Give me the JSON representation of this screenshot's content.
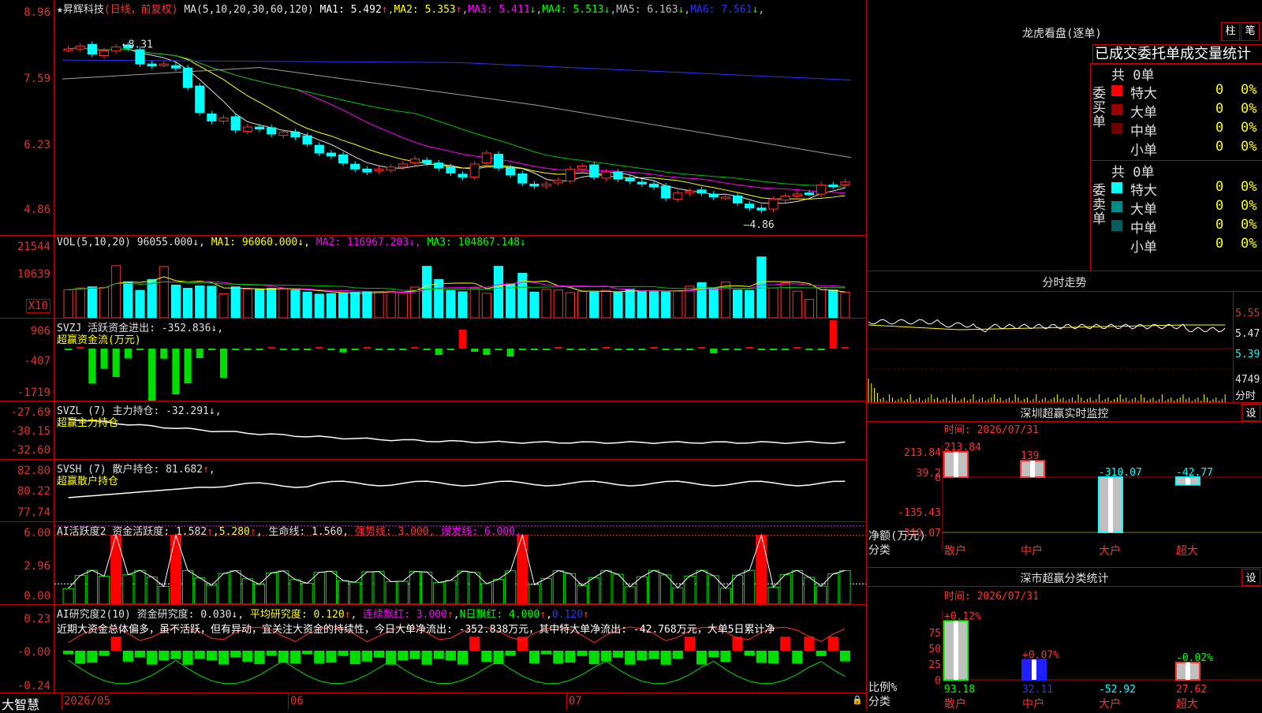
{
  "app": {
    "brand": "大智慧",
    "lock": "🔒"
  },
  "k": {
    "title": "★昇辉科技",
    "mode": "(日线，前复权)",
    "ma_head": "MA(5,10,20,30,60,120)",
    "ma": [
      {
        "t": "MA1: 5.492",
        "a": "↑",
        "c": "#ffffff"
      },
      {
        "t": "MA2: 5.353",
        "a": "↑",
        "c": "#ffff00"
      },
      {
        "t": "MA3: 5.411",
        "a": "↓",
        "c": "#ff00ff"
      },
      {
        "t": "MA4: 5.513",
        "a": "↓",
        "c": "#00ff00"
      },
      {
        "t": "MA5: 6.163",
        "a": "↓",
        "c": "#c0c0c0"
      },
      {
        "t": "MA6: 7.561",
        "a": "↓",
        "c": "#3030ff"
      }
    ],
    "ticks": [
      "8.96",
      "7.59",
      "6.23",
      "4.86"
    ],
    "hi": "8.31",
    "lo": "4.86"
  },
  "vol": {
    "head": "VOL(5,10,20)",
    "v": "96055.000",
    "ma1": "MA1: 96060.000",
    "ma2": "MA2: 116967.203",
    "ma3": "MA3: 104867.148",
    "ticks": [
      "21544",
      "10639"
    ],
    "unit": "X10"
  },
  "svzj": {
    "head": "SVZJ  活跃资金进出: -352.836",
    "sub": "超赢资金流(万元)",
    "ticks": [
      "906",
      "-407",
      "-1719"
    ]
  },
  "svzl": {
    "head": "SVZL (7) 主力持仓: -32.291",
    "sub": "超赢主力持仓",
    "ticks": [
      "-27.69",
      "-30.15",
      "-32.60"
    ]
  },
  "svsh": {
    "head": "SVSH (7) 散户持仓: 81.682",
    "sub": "超赢散户持仓",
    "ticks": [
      "82.80",
      "80.22",
      "77.74"
    ]
  },
  "ai2": {
    "head": "AI活跃度2 资金活跃度: 1.582",
    "v2": "5.280",
    "life": "生命线: 1.560",
    "strong": "强势线: 3.000",
    "burst": "爆发线: 6.000",
    "ticks": [
      "6.00",
      "2.96",
      "0.00"
    ]
  },
  "ai_r": {
    "head": "AI研究度2(10) 资金研究度: 0.030",
    "avg": "平均研究度: 0.120",
    "cont": "连续飘红: 3.000",
    "n": "N日飘红: 4.000",
    "n2": "0.120",
    "text": "近期大资金总体偏多，虽不活跃，但有异动，宜关注大资金的持续性，今日大单净流出: -352.838万元，其中特大单净流出: -42.768万元，大单5日累计净",
    "ticks": [
      "0.23",
      "-0.00",
      "-0.24"
    ]
  },
  "xaxis": [
    "2026/05",
    "06",
    "07"
  ],
  "lhb": {
    "title": "龙虎看盘(逐单)",
    "b1": "柱",
    "b2": "笔",
    "sub": "已成交委托单成交量统计",
    "buy": {
      "label": "委买单",
      "total": "共 0单",
      "rows": [
        {
          "n": "特大",
          "v": "0",
          "p": "0%",
          "c": "#ff0000"
        },
        {
          "n": "大单",
          "v": "0",
          "p": "0%",
          "c": "#a00000"
        },
        {
          "n": "中单",
          "v": "0",
          "p": "0%",
          "c": "#700000"
        },
        {
          "n": "小单",
          "v": "0",
          "p": "0%",
          "c": "#000000"
        }
      ]
    },
    "sell": {
      "label": "委卖单",
      "total": "共 0单",
      "rows": [
        {
          "n": "特大",
          "v": "0",
          "p": "0%",
          "c": "#00ffff"
        },
        {
          "n": "大单",
          "v": "0",
          "p": "0%",
          "c": "#008b8b"
        },
        {
          "n": "中单",
          "v": "0",
          "p": "0%",
          "c": "#006060"
        },
        {
          "n": "小单",
          "v": "0",
          "p": "0%",
          "c": "#000000"
        }
      ]
    }
  },
  "fs": {
    "title": "分时走势",
    "ticks": [
      "5.55",
      "5.47",
      "5.39"
    ],
    "vol": "4749",
    "vlabel": "分时"
  },
  "szm": {
    "title": "深圳超赢实时监控",
    "btn": "设",
    "time": "时间: 2026/07/31",
    "ticks": [
      "213.84",
      "39.2",
      "0",
      "-135.43",
      "-310.07"
    ],
    "ylabel": "净额(万元)",
    "xlabel": "分类",
    "cats": [
      "散户",
      "中户",
      "大户",
      "超大"
    ],
    "labels": [
      "213.84",
      "139",
      "-310.07",
      "-42.77"
    ],
    "values": [
      213.84,
      139,
      -310.07,
      -42.77
    ]
  },
  "szc": {
    "title": "深市超赢分类统计",
    "btn": "设",
    "time": "时间: 2026/07/31",
    "ticks": [
      "75",
      "50",
      "25",
      "0"
    ],
    "ylabel": "比例%",
    "xlabel": "分类",
    "cats": [
      "散户",
      "中户",
      "大户",
      "超大"
    ],
    "top": [
      "+0.12%",
      "+0.07%",
      "",
      "-0.02%"
    ],
    "bottom": [
      "93.18",
      "32.11",
      "-52.92",
      "27.62"
    ],
    "values": [
      93.18,
      32.11,
      0,
      27.62
    ]
  },
  "chart_data": [
    {
      "type": "candlestick",
      "title": "昇辉科技",
      "ylim": [
        4.5,
        9.2
      ],
      "y_ticks": [
        8.96,
        7.59,
        6.23,
        4.86
      ],
      "x_ticks": [
        "2026/05",
        "06",
        "07"
      ],
      "high": 8.31,
      "low": 4.86,
      "close": [
        8.22,
        8.28,
        8.12,
        8.18,
        8.26,
        8.24,
        7.92,
        7.88,
        7.92,
        7.84,
        7.45,
        6.95,
        6.78,
        6.84,
        6.6,
        6.66,
        6.62,
        6.52,
        6.56,
        6.46,
        6.32,
        6.14,
        6.08,
        5.94,
        5.82,
        5.76,
        5.82,
        5.86,
        5.92,
        6.02,
        5.94,
        5.84,
        5.74,
        5.66,
        5.92,
        6.14,
        5.84,
        5.7,
        5.54,
        5.48,
        5.52,
        5.6,
        5.82,
        5.88,
        5.66,
        5.76,
        5.62,
        5.58,
        5.52,
        5.46,
        5.24,
        5.34,
        5.38,
        5.34,
        5.26,
        5.26,
        5.14,
        5.04,
        5.0,
        5.22,
        5.28,
        5.32,
        5.34,
        5.5,
        5.48,
        5.56
      ]
    },
    {
      "type": "bar",
      "title": "VOL",
      "ylim": [
        0,
        28000
      ],
      "values": [
        9600,
        10200,
        10600,
        10400,
        17800,
        12300,
        9400,
        13100,
        17500,
        11200,
        10100,
        10900,
        10800,
        8200,
        10600,
        9800,
        9900,
        10100,
        9900,
        9500,
        8800,
        8100,
        8300,
        8400,
        8700,
        8900,
        9000,
        9100,
        8400,
        10500,
        17600,
        13100,
        9300,
        8900,
        10200,
        8400,
        17600,
        11600,
        15200,
        8800,
        9700,
        9500,
        8600,
        9000,
        8800,
        9400,
        8700,
        9800,
        9200,
        9100,
        8900,
        9100,
        10800,
        12000,
        10300,
        12200,
        9500,
        9300,
        20800,
        10200,
        12000,
        9100,
        6300,
        10400,
        9500,
        8800
      ],
      "series": [
        {
          "name": "MA1"
        },
        {
          "name": "MA2"
        },
        {
          "name": "MA3"
        }
      ]
    },
    {
      "type": "bar",
      "title": "超赢资金流(万元)",
      "values": [
        0,
        0,
        -1110,
        -640,
        -900,
        -310,
        0,
        -1719,
        -320,
        -1450,
        -1100,
        -300,
        0,
        -930,
        0,
        0,
        0,
        0,
        0,
        0,
        0,
        0,
        0,
        -120,
        0,
        0,
        0,
        0,
        0,
        0,
        0,
        -200,
        0,
        600,
        -100,
        -200,
        0,
        -250,
        0,
        0,
        0,
        0,
        0,
        0,
        0,
        0,
        0,
        0,
        0,
        0,
        0,
        0,
        0,
        0,
        -150,
        0,
        0,
        0,
        0,
        0,
        0,
        0,
        0,
        0,
        906,
        0
      ]
    },
    {
      "type": "line",
      "title": "超赢主力持仓",
      "ylim": [
        -33.2,
        -27.2
      ],
      "y_ticks": [
        -27.69,
        -30.15,
        -32.6
      ]
    },
    {
      "type": "line",
      "title": "超赢散户持仓",
      "ylim": [
        77.4,
        83.2
      ],
      "y_ticks": [
        82.8,
        80.22,
        77.74
      ]
    },
    {
      "type": "bar",
      "title": "AI活跃度2",
      "ylim": [
        0,
        6.3
      ],
      "y_ticks": [
        6,
        2.96,
        0
      ]
    },
    {
      "type": "bar",
      "title": "AI研究度2(10)",
      "ylim": [
        -0.26,
        0.25
      ],
      "y_ticks": [
        0.23,
        -0.0,
        -0.24
      ]
    },
    {
      "type": "bar",
      "title": "深圳超赢实时监控",
      "categories": [
        "散户",
        "中户",
        "大户",
        "超大"
      ],
      "values": [
        213.84,
        139,
        -310.07,
        -42.77
      ],
      "ylim": [
        -310.07,
        213.84
      ]
    },
    {
      "type": "bar",
      "title": "深市超赢分类统计",
      "categories": [
        "散户",
        "中户",
        "大户",
        "超大"
      ],
      "values": [
        93.18,
        32.11,
        0,
        27.62
      ]
    }
  ]
}
